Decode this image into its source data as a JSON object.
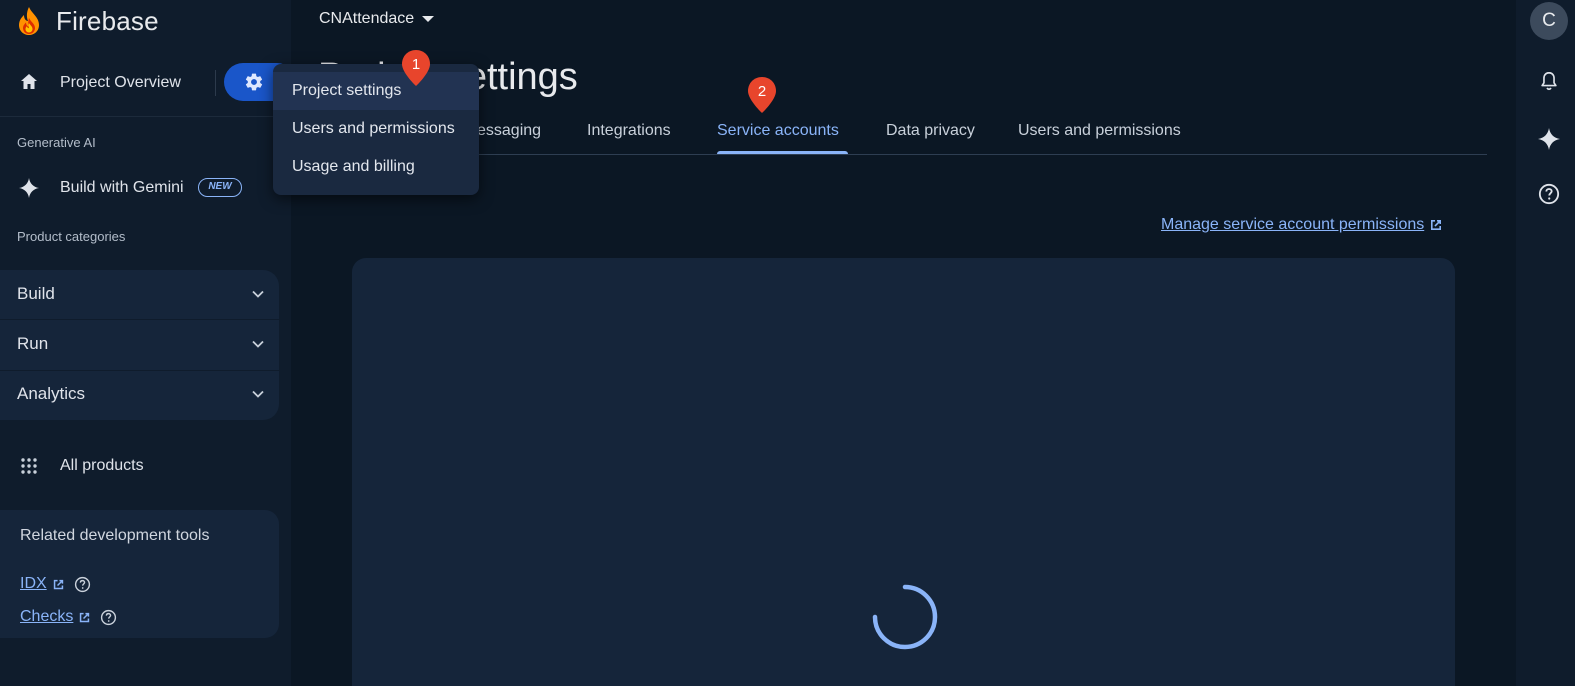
{
  "app": {
    "brand": "Firebase"
  },
  "sidebar": {
    "overview_label": "Project Overview",
    "gen_ai_label": "Generative AI",
    "gemini_label": "Build with Gemini",
    "new_badge": "NEW",
    "product_categories_label": "Product categories",
    "categories": [
      {
        "label": "Build"
      },
      {
        "label": "Run"
      },
      {
        "label": "Analytics"
      }
    ],
    "all_products_label": "All products",
    "related_tools": {
      "title": "Related development tools",
      "links": [
        {
          "label": "IDX"
        },
        {
          "label": "Checks"
        }
      ]
    }
  },
  "header": {
    "project_name": "CNAttendace",
    "page_title": "Project settings"
  },
  "tabs": [
    {
      "label": "essaging"
    },
    {
      "label": "Integrations"
    },
    {
      "label": "Service accounts",
      "active": true
    },
    {
      "label": "Data privacy"
    },
    {
      "label": "Users and permissions"
    }
  ],
  "main": {
    "manage_link": "Manage service account permissions"
  },
  "settings_menu": {
    "items": [
      {
        "label": "Project settings"
      },
      {
        "label": "Users and permissions"
      },
      {
        "label": "Usage and billing"
      }
    ]
  },
  "step_badges": [
    "1",
    "2"
  ],
  "user": {
    "avatar_initial": "C"
  },
  "colors": {
    "accent": "#8ab4f8",
    "gear_button": "#1a56c9",
    "badge": "#e8452c",
    "background": "#0b1724"
  }
}
